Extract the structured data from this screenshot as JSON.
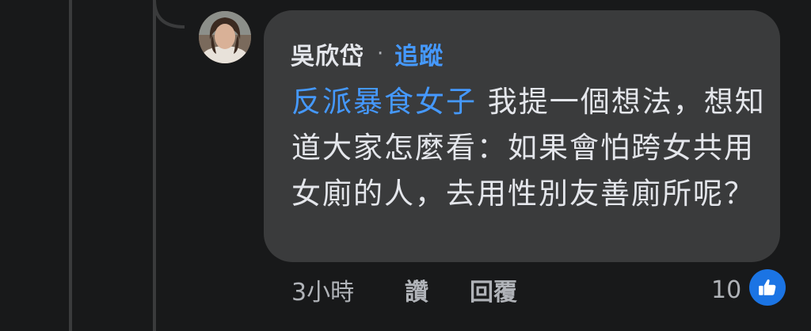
{
  "comment": {
    "author": "吳欣岱",
    "separator": "·",
    "follow_label": "追蹤",
    "mention": "反派暴食女子",
    "text": " 我提一個想法，想知道大家怎麼看：如果會怕跨女共用女廁的人，去用性別友善廁所呢？",
    "time": "3小時",
    "like_label": "讚",
    "reply_label": "回覆",
    "reaction_count": "10"
  },
  "icons": {
    "reaction": "thumbs-up-icon",
    "avatar": "user-avatar"
  },
  "colors": {
    "background": "#18191a",
    "bubble": "#3a3b3c",
    "text": "#e4e6eb",
    "secondary_text": "#b0b3b8",
    "link": "#4599ff",
    "like_badge": "#1b74e4"
  }
}
